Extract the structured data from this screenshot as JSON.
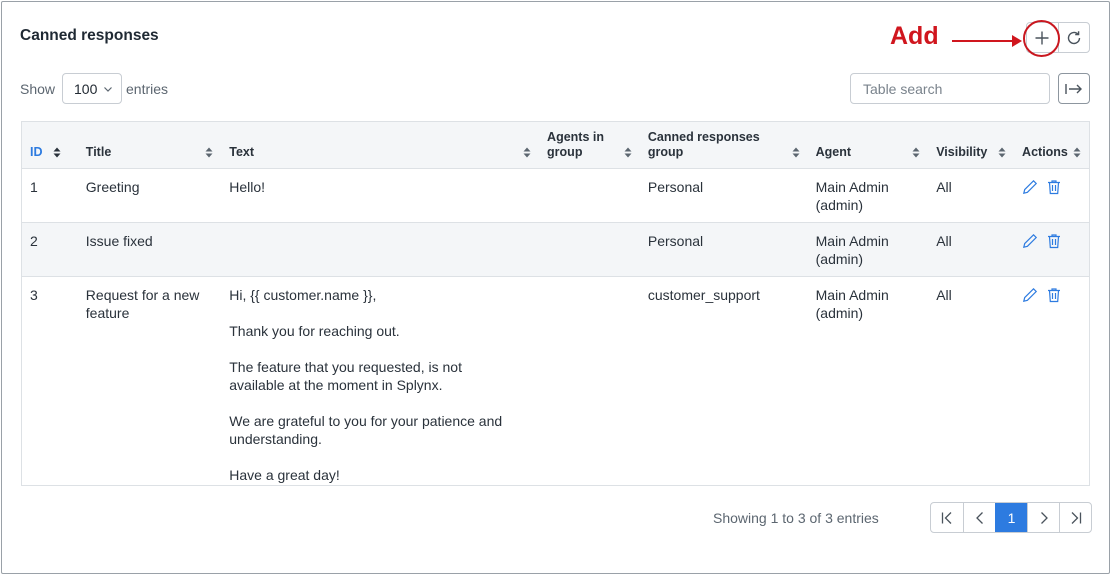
{
  "header": {
    "title": "Canned responses",
    "annotation": "Add",
    "add_icon": "plus-icon",
    "refresh_icon": "refresh-icon"
  },
  "controls": {
    "show_label": "Show",
    "entries_value": "100",
    "entries_label": "entries",
    "search_placeholder": "Table search",
    "export_icon": "arrow-to-right-icon"
  },
  "table": {
    "columns": [
      {
        "label": "ID"
      },
      {
        "label": "Title"
      },
      {
        "label": "Text"
      },
      {
        "label": "Agents in group"
      },
      {
        "label": "Canned responses group"
      },
      {
        "label": "Agent"
      },
      {
        "label": "Visibility"
      },
      {
        "label": "Actions"
      }
    ],
    "rows": [
      {
        "id": "1",
        "title": "Greeting",
        "text": [
          "Hello!"
        ],
        "agents_in_group": "",
        "group": "Personal",
        "agent": "Main Admin (admin)",
        "visibility": "All"
      },
      {
        "id": "2",
        "title": "Issue fixed",
        "text": [],
        "agents_in_group": "",
        "group": "Personal",
        "agent": "Main Admin (admin)",
        "visibility": "All"
      },
      {
        "id": "3",
        "title": "Request for a new feature",
        "text": [
          "Hi, {{ customer.name }},",
          "Thank you for reaching out.",
          "The feature that you requested, is not available at the moment in Splynx.",
          "We are grateful to you for your patience and understanding.",
          "Have a great day!"
        ],
        "agents_in_group": "",
        "group": "customer_support",
        "agent": "Main Admin (admin)",
        "visibility": "All"
      }
    ]
  },
  "footer": {
    "showing_text": "Showing 1 to 3 of 3 entries",
    "current_page": "1"
  },
  "colors": {
    "accent": "#2d7be0",
    "annotation": "#d0161e"
  }
}
